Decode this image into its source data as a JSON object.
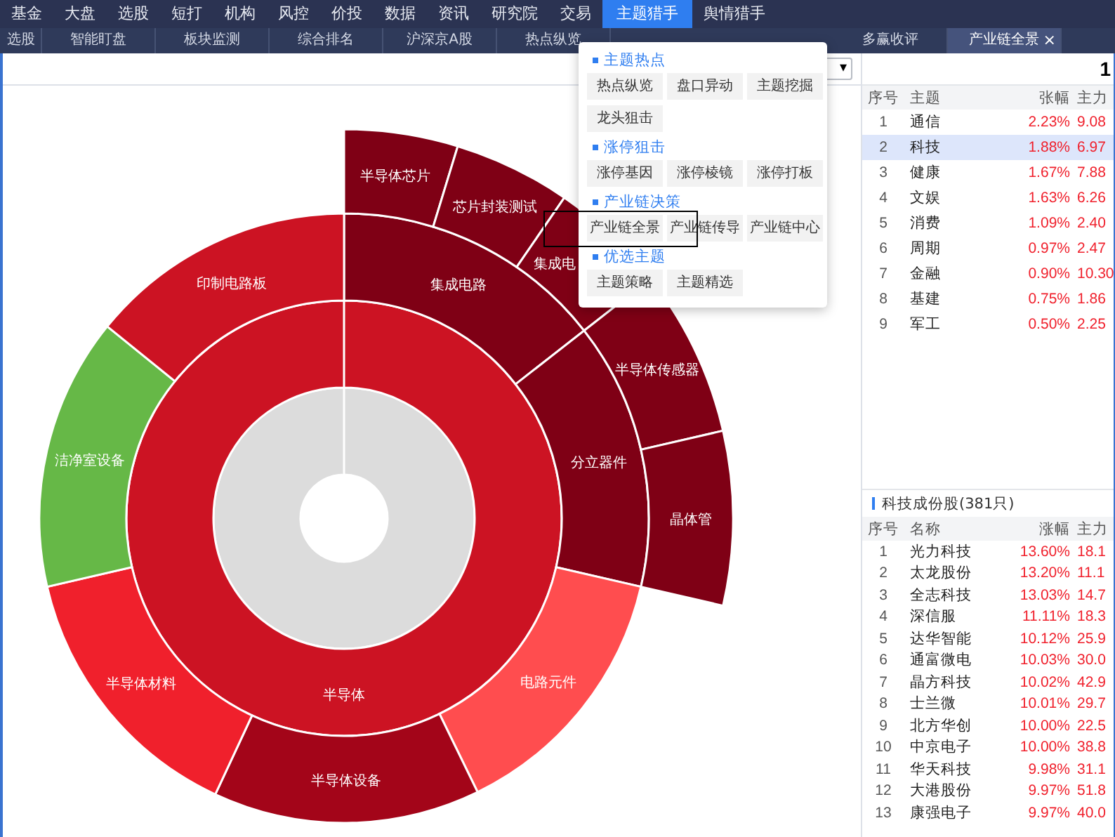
{
  "nav": [
    {
      "label": "基金",
      "selected": false
    },
    {
      "label": "大盘",
      "selected": false
    },
    {
      "label": "选股",
      "selected": false
    },
    {
      "label": "短打",
      "selected": false
    },
    {
      "label": "机构",
      "selected": false
    },
    {
      "label": "风控",
      "selected": false
    },
    {
      "label": "价投",
      "selected": false
    },
    {
      "label": "数据",
      "selected": false
    },
    {
      "label": "资讯",
      "selected": false
    },
    {
      "label": "研究院",
      "selected": false
    },
    {
      "label": "交易",
      "selected": false
    },
    {
      "label": "主题猎手",
      "selected": true
    },
    {
      "label": "舆情猎手",
      "selected": false
    }
  ],
  "tabs_left": [
    {
      "label": "选股",
      "selected": false
    },
    {
      "label": "智能盯盘",
      "selected": false
    },
    {
      "label": "板块监测",
      "selected": false
    },
    {
      "label": "综合排名",
      "selected": false
    },
    {
      "label": "沪深京A股",
      "selected": false
    },
    {
      "label": "热点纵览",
      "selected": false
    }
  ],
  "tabs_right": [
    {
      "label": "多赢收评",
      "selected": false
    },
    {
      "label": "产业链全景",
      "selected": true,
      "close": "×"
    }
  ],
  "toolbar": {
    "select_caret": "▾"
  },
  "sunburst": {
    "rings": [
      [
        {
          "color": "#dcdcdc"
        }
      ],
      [
        {
          "label": "半导体",
          "color": "#cc1323"
        }
      ],
      [
        {
          "label": "集成电路",
          "color": "#7f0015"
        },
        {
          "label": "分立器件",
          "color": "#7f0015"
        },
        {
          "label": "电路元件",
          "color": "#ff4d4f"
        },
        {
          "label": "半导体设备",
          "color": "#a30519"
        },
        {
          "label": "半导体材料",
          "color": "#f0202c"
        },
        {
          "label": "洁净室设备",
          "color": "#66b847"
        },
        {
          "label": "印制电路板",
          "color": "#cc1323"
        }
      ],
      [
        {
          "label": "半导体芯片",
          "color": "#7f0015"
        },
        {
          "label": "芯片封装测试",
          "color": "#7f0015"
        },
        {
          "label": "集成电",
          "color": "#7f0015"
        },
        {
          "label": "半导体传感器",
          "color": "#7f0015"
        },
        {
          "label": "晶体管",
          "color": "#7f0015"
        }
      ]
    ]
  },
  "menu": {
    "sections": [
      {
        "title": "主题热点",
        "items": [
          "热点纵览",
          "盘口异动",
          "主题挖掘",
          "龙头狙击"
        ]
      },
      {
        "title": "涨停狙击",
        "items": [
          "涨停基因",
          "涨停棱镜",
          "涨停打板"
        ]
      },
      {
        "title": "产业链决策",
        "items": [
          "产业链全景",
          "产业链传导",
          "产业链中心"
        ]
      },
      {
        "title": "优选主题",
        "items": [
          "主题策略",
          "主题精选"
        ]
      }
    ]
  },
  "panel": {
    "header_value": "1",
    "themes": {
      "columns": [
        "序号",
        "主题",
        "张幅",
        "主力"
      ],
      "rows": [
        {
          "cells": [
            "1",
            "通信",
            "2.23%",
            "9.08"
          ],
          "selected": false
        },
        {
          "cells": [
            "2",
            "科技",
            "1.88%",
            "6.97"
          ],
          "selected": true
        },
        {
          "cells": [
            "3",
            "健康",
            "1.67%",
            "7.88"
          ],
          "selected": false
        },
        {
          "cells": [
            "4",
            "文娱",
            "1.63%",
            "6.26"
          ],
          "selected": false
        },
        {
          "cells": [
            "5",
            "消费",
            "1.09%",
            "2.40"
          ],
          "selected": false
        },
        {
          "cells": [
            "6",
            "周期",
            "0.97%",
            "2.47"
          ],
          "selected": false
        },
        {
          "cells": [
            "7",
            "金融",
            "0.90%",
            "10.30"
          ],
          "selected": false
        },
        {
          "cells": [
            "8",
            "基建",
            "0.75%",
            "1.86"
          ],
          "selected": false
        },
        {
          "cells": [
            "9",
            "军工",
            "0.50%",
            "2.25"
          ],
          "selected": false
        }
      ]
    },
    "stocks": {
      "title": "科技成份股(381只)",
      "columns": [
        "序号",
        "名称",
        "涨幅",
        "主力"
      ],
      "rows": [
        [
          "1",
          "光力科技",
          "13.60%",
          "18.1"
        ],
        [
          "2",
          "太龙股份",
          "13.20%",
          "11.1"
        ],
        [
          "3",
          "全志科技",
          "13.03%",
          "14.7"
        ],
        [
          "4",
          "深信服",
          "11.11%",
          "18.3"
        ],
        [
          "5",
          "达华智能",
          "10.12%",
          "25.9"
        ],
        [
          "6",
          "通富微电",
          "10.03%",
          "30.0"
        ],
        [
          "7",
          "晶方科技",
          "10.02%",
          "42.9"
        ],
        [
          "8",
          "士兰微",
          "10.01%",
          "29.7"
        ],
        [
          "9",
          "北方华创",
          "10.00%",
          "22.5"
        ],
        [
          "10",
          "中京电子",
          "10.00%",
          "38.8"
        ],
        [
          "11",
          "华天科技",
          "9.98%",
          "31.1"
        ],
        [
          "12",
          "大港股份",
          "9.97%",
          "51.8"
        ],
        [
          "13",
          "康强电子",
          "9.97%",
          "40.0"
        ]
      ]
    }
  }
}
